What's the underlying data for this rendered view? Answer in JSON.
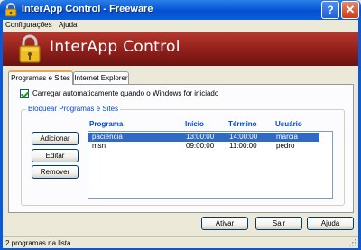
{
  "window": {
    "title": "InterApp Control - Freeware",
    "help_glyph": "?",
    "close_glyph": "✕"
  },
  "menu": {
    "items": [
      "Configurações",
      "Ajuda"
    ]
  },
  "banner": {
    "title": "InterApp Control"
  },
  "tabs": [
    {
      "label": "Programas e Sites",
      "active": true
    },
    {
      "label": "Internet Explorer",
      "active": false
    }
  ],
  "autostart": {
    "label": "Carregar automaticamente quando o Windows for iniciado",
    "checked": true
  },
  "group": {
    "legend": "Bloquear Programas e Sites",
    "buttons": [
      "Adicionar",
      "Editar",
      "Remover"
    ],
    "columns": [
      "Programa",
      "Início",
      "Término",
      "Usuário"
    ],
    "rows": [
      {
        "programa": "paciência",
        "inicio": "13:00:00",
        "termino": "14:00:00",
        "usuario": "marcia",
        "selected": true
      },
      {
        "programa": "msn",
        "inicio": "09:00:00",
        "termino": "11:00:00",
        "usuario": "pedro",
        "selected": false
      }
    ]
  },
  "footer": {
    "buttons": [
      "Ativar",
      "Sair",
      "Ajuda"
    ]
  },
  "status": {
    "text": "2 programas na lista"
  },
  "colors": {
    "title_bar": "#0a5ad8",
    "banner": "#8f1f1a",
    "selection": "#316ac5",
    "group_text": "#0046d5"
  }
}
